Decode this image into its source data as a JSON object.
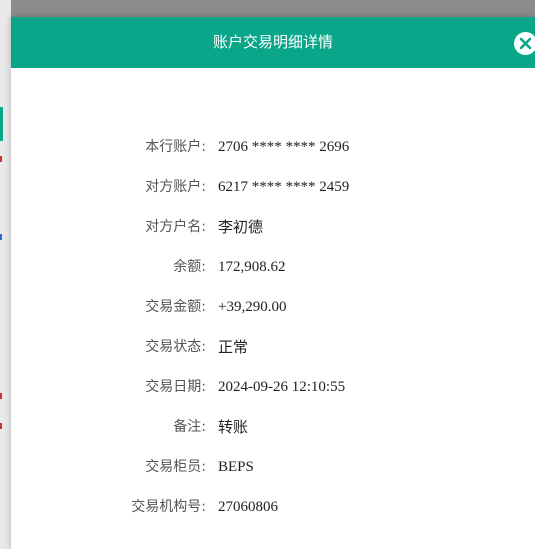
{
  "dialog": {
    "title": "账户交易明细详情",
    "close_icon": "close-icon"
  },
  "details": [
    {
      "key": "own_account",
      "label": "本行账户:",
      "value": "2706 **** **** 2696",
      "script": "latin"
    },
    {
      "key": "counterparty_account",
      "label": "对方账户:",
      "value": "6217 **** **** 2459",
      "script": "latin"
    },
    {
      "key": "counterparty_name",
      "label": "对方户名:",
      "value": "李初德",
      "script": "cjk"
    },
    {
      "key": "balance",
      "label": "余额:",
      "value": "172,908.62",
      "script": "latin"
    },
    {
      "key": "amount",
      "label": "交易金额:",
      "value": "+39,290.00",
      "script": "latin"
    },
    {
      "key": "status",
      "label": "交易状态:",
      "value": "正常",
      "script": "cjk"
    },
    {
      "key": "date",
      "label": "交易日期:",
      "value": "2024-09-26 12:10:55",
      "script": "latin"
    },
    {
      "key": "remark",
      "label": "备注:",
      "value": "转账",
      "script": "cjk"
    },
    {
      "key": "teller",
      "label": "交易柜员:",
      "value": "BEPS",
      "script": "latin"
    },
    {
      "key": "institution",
      "label": "交易机构号:",
      "value": "27060806",
      "script": "latin"
    }
  ],
  "colors": {
    "header": "#0aa68a",
    "header_text": "#ffffff",
    "label_text": "#555555",
    "value_text": "#222222"
  }
}
